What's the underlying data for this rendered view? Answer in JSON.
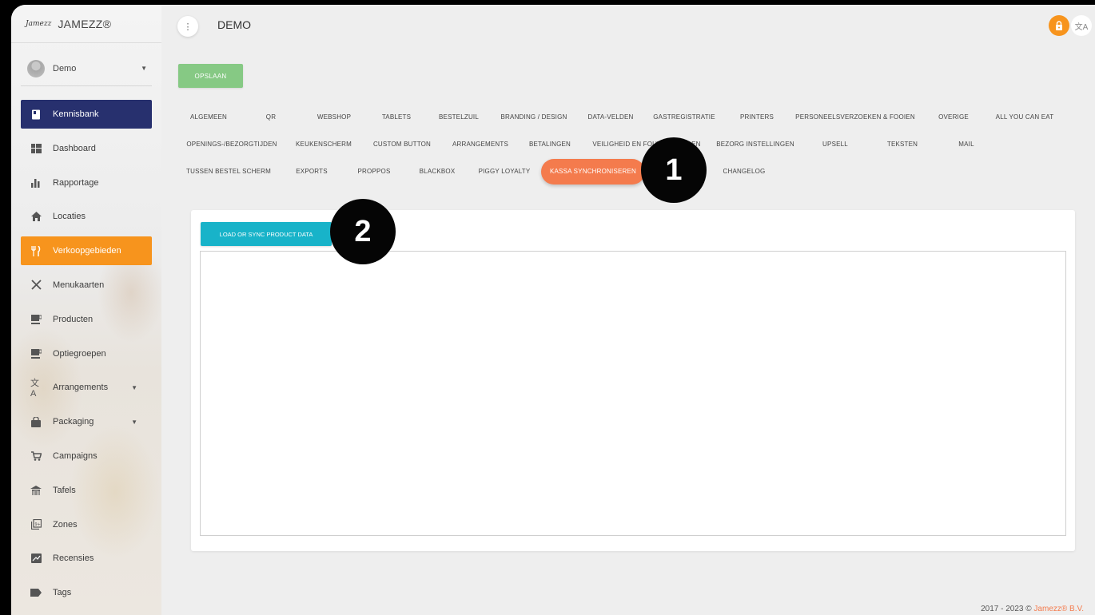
{
  "brand": {
    "logo": "Jamezz",
    "name": "JAMEZZ®"
  },
  "user": {
    "name": "Demo"
  },
  "nav": [
    {
      "label": "Kennisbank",
      "icon": "book-icon"
    },
    {
      "label": "Dashboard",
      "icon": "dashboard-icon"
    },
    {
      "label": "Rapportage",
      "icon": "bar-chart-icon"
    },
    {
      "label": "Locaties",
      "icon": "home-icon"
    },
    {
      "label": "Verkoopgebieden",
      "icon": "restaurant-icon"
    },
    {
      "label": "Menukaarten",
      "icon": "cutlery-icon"
    },
    {
      "label": "Producten",
      "icon": "coffee-icon"
    },
    {
      "label": "Optiegroepen",
      "icon": "coffee-icon"
    },
    {
      "label": "Arrangements",
      "icon": "translate-icon"
    },
    {
      "label": "Packaging",
      "icon": "bag-icon"
    },
    {
      "label": "Campaigns",
      "icon": "cart-icon"
    },
    {
      "label": "Tafels",
      "icon": "table-icon"
    },
    {
      "label": "Zones",
      "icon": "zones-icon"
    },
    {
      "label": "Recensies",
      "icon": "review-icon"
    },
    {
      "label": "Tags",
      "icon": "tag-icon"
    }
  ],
  "header": {
    "title": "DEMO",
    "menu_glyph": "⋮"
  },
  "toolbar": {
    "save_label": "OPSLAAN"
  },
  "tabs": {
    "row1": [
      "ALGEMEEN",
      "QR",
      "WEBSHOP",
      "TABLETS",
      "BESTELZUIL",
      "BRANDING / DESIGN",
      "DATA-VELDEN",
      "GASTREGISTRATIE",
      "PRINTERS",
      "PERSONEELSVERZOEKEN & FOOIEN",
      "OVERIGE",
      "ALL YOU CAN EAT"
    ],
    "row2": [
      "OPENINGS-/BEZORGTIJDEN",
      "KEUKENSCHERM",
      "CUSTOM BUTTON",
      "ARRANGEMENTS",
      "BETALINGEN",
      "VEILIGHEID EN FOUTMELDINGEN",
      "BEZORG INSTELLINGEN",
      "UPSELL",
      "TEKSTEN",
      "MAIL"
    ],
    "row3": [
      "TUSSEN BESTEL SCHERM",
      "EXPORTS",
      "PROPPOS",
      "BLACKBOX",
      "PIGGY LOYALTY",
      "KASSA SYNCHRONISEREN",
      "CHANGELOG"
    ],
    "active": "KASSA SYNCHRONISEREN"
  },
  "sync_panel": {
    "button_label": "LOAD OR SYNC PRODUCT DATA"
  },
  "steps": [
    "1",
    "2"
  ],
  "footer": {
    "years": "2017 - 2023 ©",
    "company": "Jamezz® B.V."
  },
  "colors": {
    "accent": "#f7941d",
    "kb": "#27306e",
    "save": "#86c984",
    "sync": "#18b3c9",
    "tab_active": "#f47b4d"
  }
}
